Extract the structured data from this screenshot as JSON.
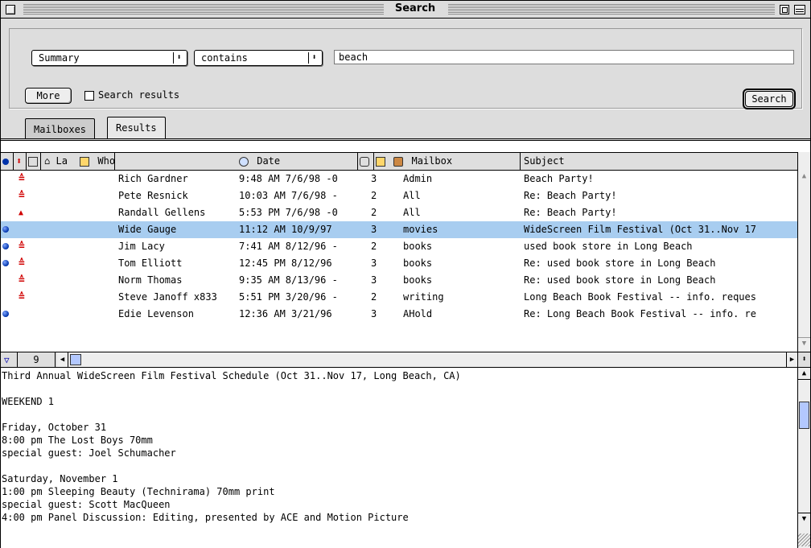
{
  "window": {
    "title": "Search"
  },
  "criteria": {
    "field_value": "Summary",
    "operator_value": "contains",
    "search_text": "beach",
    "more_label": "More",
    "search_results_label": "Search results",
    "search_button_label": "Search"
  },
  "tabs": [
    {
      "label": "Mailboxes"
    },
    {
      "label": "Results"
    }
  ],
  "table": {
    "columns": {
      "label_col": "La",
      "who": "Who",
      "date": "Date",
      "mailbox": "Mailbox",
      "subject": "Subject"
    },
    "rows": [
      {
        "status": "",
        "priority": "highest",
        "who": "Rich Gardner",
        "date": "9:48 AM 7/6/98 -0",
        "size": "3",
        "mailbox": "Admin",
        "subject": "Beach Party!"
      },
      {
        "status": "",
        "priority": "highest",
        "who": "Pete Resnick",
        "date": "10:03 AM 7/6/98 -",
        "size": "2",
        "mailbox": "All",
        "subject": "Re: Beach Party!"
      },
      {
        "status": "",
        "priority": "high",
        "who": "Randall Gellens",
        "date": "5:53 PM 7/6/98 -0",
        "size": "2",
        "mailbox": "All",
        "subject": "Re: Beach Party!"
      },
      {
        "status": "unread",
        "priority": "",
        "who": "Wide Gauge",
        "date": "11:12 AM 10/9/97",
        "size": "3",
        "mailbox": "movies",
        "subject": "WideScreen Film Festival (Oct 31..Nov 17"
      },
      {
        "status": "unread",
        "priority": "highest",
        "who": "Jim Lacy",
        "date": "7:41 AM 8/12/96 -",
        "size": "2",
        "mailbox": "books",
        "subject": "used book store in Long Beach"
      },
      {
        "status": "unread",
        "priority": "highest",
        "who": "Tom Elliott",
        "date": "12:45 PM 8/12/96",
        "size": "3",
        "mailbox": "books",
        "subject": "Re: used book store in Long Beach"
      },
      {
        "status": "",
        "priority": "highest",
        "who": "Norm Thomas",
        "date": "9:35 AM 8/13/96 -",
        "size": "3",
        "mailbox": "books",
        "subject": "Re: used book store in Long Beach"
      },
      {
        "status": "",
        "priority": "highest",
        "who": "Steve Janoff x833",
        "date": "5:51 PM 3/20/96 -",
        "size": "2",
        "mailbox": "writing",
        "subject": "Long Beach Book Festival -- info. reques"
      },
      {
        "status": "unread",
        "priority": "",
        "who": "Edie Levenson",
        "date": "12:36 AM 3/21/96",
        "size": "3",
        "mailbox": "AHold",
        "subject": "Re: Long Beach Book Festival -- info. re"
      }
    ],
    "selected_index": 3,
    "result_count": "9"
  },
  "preview": {
    "lines": [
      "Third Annual WideScreen Film Festival Schedule (Oct 31..Nov 17, Long Beach, CA)",
      "",
      "WEEKEND 1",
      "",
      "Friday, October 31",
      "8:00 pm The Lost Boys 70mm",
      "special guest: Joel Schumacher",
      "",
      "Saturday, November 1",
      "1:00 pm Sleeping Beauty (Technirama) 70mm print",
      "special guest: Scott MacQueen",
      "4:00 pm Panel Discussion: Editing, presented by ACE and Motion Picture"
    ]
  },
  "colors": {
    "selection": "#a8cdf0",
    "priority": "#d00000",
    "unread_dot": "#0033aa",
    "chrome": "#dddddd"
  },
  "icons": {
    "status_column": "status-dot-icon",
    "priority_column": "priority-arrows-icon",
    "attachment_column": "attachment-icon",
    "label_column": "label-tag-icon",
    "who_column": "person-icon",
    "date_column": "clock-icon",
    "server_column": "server-icon",
    "mailbox_column": "mailbox-icon"
  }
}
